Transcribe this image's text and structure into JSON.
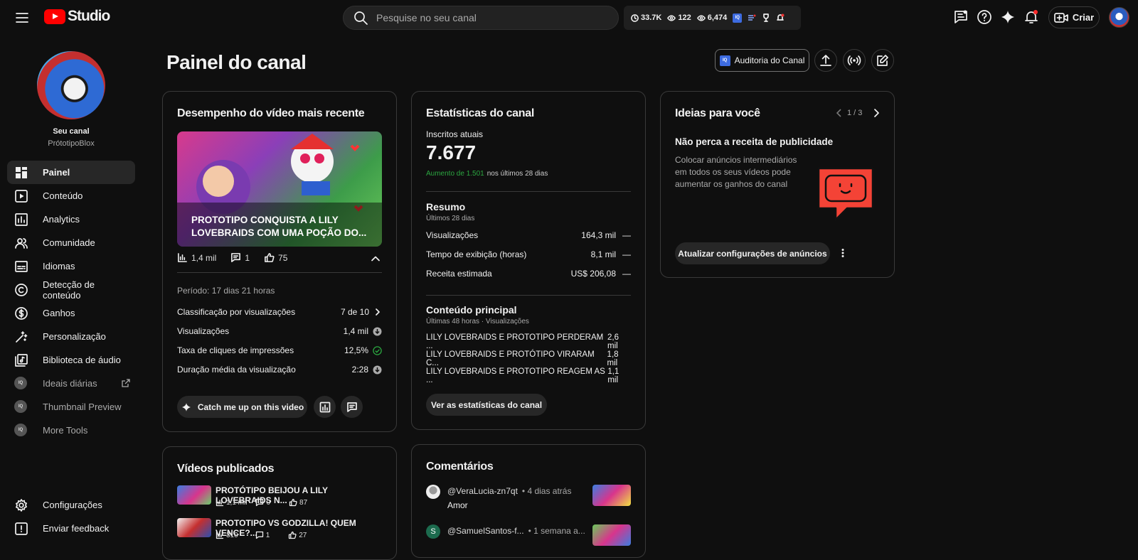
{
  "app": {
    "name": "Studio"
  },
  "search": {
    "placeholder": "Pesquise no seu canal"
  },
  "topstats": {
    "views": "33.7K",
    "watching": "122",
    "eye": "6,474"
  },
  "create": {
    "label": "Criar"
  },
  "channel": {
    "label": "Seu canal",
    "handle": "PrótotipoBlox"
  },
  "sidebar": {
    "items": [
      {
        "label": "Painel",
        "icon": "dashboard-icon"
      },
      {
        "label": "Conteúdo",
        "icon": "content-icon"
      },
      {
        "label": "Analytics",
        "icon": "analytics-icon"
      },
      {
        "label": "Comunidade",
        "icon": "community-icon"
      },
      {
        "label": "Idiomas",
        "icon": "subtitles-icon"
      },
      {
        "label": "Detecção de conteúdo",
        "icon": "copyright-icon"
      },
      {
        "label": "Ganhos",
        "icon": "dollar-icon"
      },
      {
        "label": "Personalização",
        "icon": "magic-wand-icon"
      },
      {
        "label": "Biblioteca de áudio",
        "icon": "audio-library-icon"
      },
      {
        "label": "Ideais diárias",
        "icon": "iq-icon"
      },
      {
        "label": "Thumbnail Preview",
        "icon": "iq-icon"
      },
      {
        "label": "More Tools",
        "icon": "iq-icon"
      }
    ],
    "settings": "Configurações",
    "feedback": "Enviar feedback"
  },
  "page": {
    "title": "Painel do canal",
    "audit_label": "Auditoria do Canal"
  },
  "latest": {
    "title": "Desempenho do vídeo mais recente",
    "thumb_title": "PROTOTIPO CONQUISTA A LILY LOVEBRAIDS COM UMA POÇÃO DO...",
    "views": "1,4 mil",
    "comments": "1",
    "likes": "75",
    "period": "Período: 17 dias 21 horas",
    "rows": [
      {
        "label": "Classificação por visualizações",
        "value": "7 de 10"
      },
      {
        "label": "Visualizações",
        "value": "1,4 mil"
      },
      {
        "label": "Taxa de cliques de impressões",
        "value": "12,5%"
      },
      {
        "label": "Duração média da visualização",
        "value": "2:28"
      }
    ],
    "catch_label": "Catch me up on this video"
  },
  "stats": {
    "title": "Estatísticas do canal",
    "subs_label": "Inscritos atuais",
    "subs": "7.677",
    "growth": "Aumento de 1.501",
    "growth_suffix": "nos últimos 28 dias",
    "summary_title": "Resumo",
    "summary_sub": "Últimos 28 dias",
    "summary": [
      {
        "label": "Visualizações",
        "value": "164,3 mil",
        "trend": "—"
      },
      {
        "label": "Tempo de exibição (horas)",
        "value": "8,1 mil",
        "trend": "—"
      },
      {
        "label": "Receita estimada",
        "value": "US$ 206,08",
        "trend": "—"
      }
    ],
    "top_title": "Conteúdo principal",
    "top_sub": "Últimas 48 horas · Visualizações",
    "top": [
      {
        "label": "LILY LOVEBRAIDS E PROTOTIPO PERDERAM ...",
        "value": "2,6 mil"
      },
      {
        "label": "LILY LOVEBRAIDS E PROTÓTIPO VIRARAM C...",
        "value": "1,8 mil"
      },
      {
        "label": "LILY LOVEBRAIDS E PROTOTIPO REAGEM AS ...",
        "value": "1,1 mil"
      }
    ],
    "button": "Ver as estatísticas do canal"
  },
  "ideas": {
    "title": "Ideias para você",
    "pager": "1 / 3",
    "headline": "Não perca a receita de publicidade",
    "body": "Colocar anúncios intermediários em todos os seus vídeos pode aumentar os ganhos do canal",
    "button": "Atualizar configurações de anúncios"
  },
  "published": {
    "title": "Vídeos publicados",
    "items": [
      {
        "title": "PROTÓTIPO BEIJOU A LILY LOVEBRAIDS N...",
        "views": "1,1 mil",
        "comments": "0",
        "likes": "87"
      },
      {
        "title": "PROTOTIPO VS GODZILLA! QUEM VENCE?...",
        "views": "310",
        "comments": "1",
        "likes": "27"
      }
    ]
  },
  "comments": {
    "title": "Comentários",
    "items": [
      {
        "author": "@VeraLucia-zn7qt",
        "time": "• 4 dias atrás",
        "text": "Amor"
      },
      {
        "author": "@SamuelSantos-f...",
        "time": "• 1 semana a...",
        "initial": "S"
      }
    ]
  }
}
